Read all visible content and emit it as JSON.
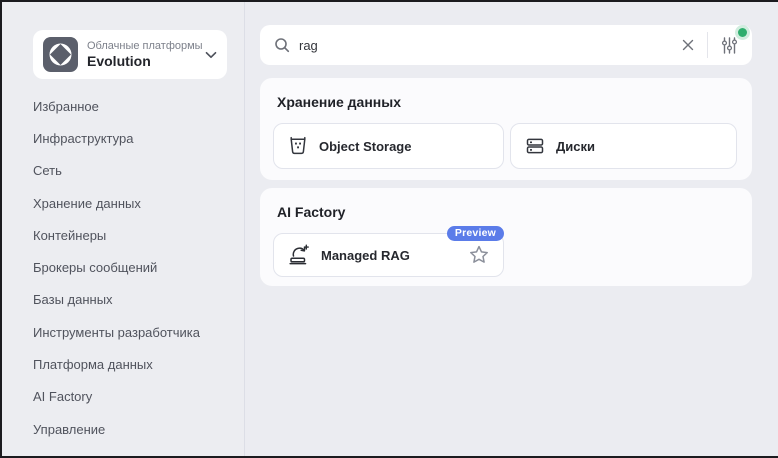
{
  "platform_switcher": {
    "label": "Облачные платформы",
    "name": "Evolution",
    "logo_icon": "cloud-platform-logo-icon",
    "chevron_icon": "chevron-down-icon"
  },
  "sidebar": {
    "items": [
      {
        "label": "Избранное"
      },
      {
        "label": "Инфраструктура"
      },
      {
        "label": "Сеть"
      },
      {
        "label": "Хранение данных"
      },
      {
        "label": "Контейнеры"
      },
      {
        "label": "Брокеры сообщений"
      },
      {
        "label": "Базы данных"
      },
      {
        "label": "Инструменты разработчика"
      },
      {
        "label": "Платформа данных"
      },
      {
        "label": "AI Factory"
      },
      {
        "label": "Управление"
      }
    ]
  },
  "search": {
    "value": "rag",
    "icons": [
      "search-icon",
      "clear-icon",
      "filter-sliders-icon"
    ],
    "status_dot_color": "#2fae6e"
  },
  "sections": [
    {
      "title": "Хранение данных",
      "cards": [
        {
          "label": "Object Storage",
          "icon": "bucket-icon"
        },
        {
          "label": "Диски",
          "icon": "disks-icon"
        }
      ]
    },
    {
      "title": "AI Factory",
      "cards": [
        {
          "label": "Managed RAG",
          "icon": "rag-book-refresh-icon",
          "badge": "Preview",
          "favorite_icon": "star-icon"
        }
      ]
    }
  ],
  "colors": {
    "page_background": "#ebecf1",
    "panel_background": "#fbfbfd",
    "card_border": "#e2e4ec",
    "badge_blue": "#5b7ce9",
    "status_green": "#2fae6e",
    "logo_gray": "#5b5f6b",
    "window_border": "#1b1b1f"
  }
}
